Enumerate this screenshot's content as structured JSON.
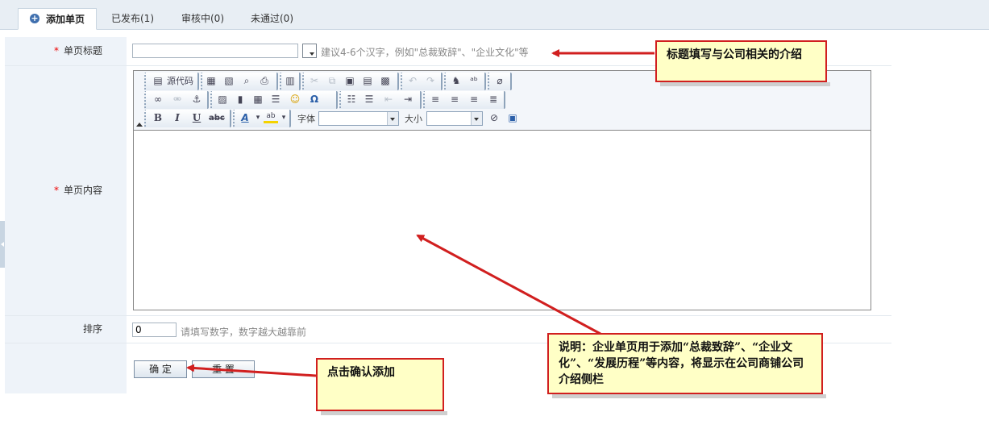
{
  "tabs": [
    {
      "label": "添加单页",
      "active": true
    },
    {
      "label": "已发布(1)",
      "active": false
    },
    {
      "label": "审核中(0)",
      "active": false
    },
    {
      "label": "未通过(0)",
      "active": false
    }
  ],
  "form": {
    "title_label": "单页标题",
    "required_mark": "*",
    "title_value": "",
    "title_hint": "建议4-6个汉字，例如\"总裁致辞\"、\"企业文化\"等",
    "content_label": "单页内容",
    "sort_label": "排序",
    "sort_value": "0",
    "sort_hint": "请填写数字，数字越大越靠前",
    "confirm_label": "确 定",
    "reset_label": "重 置"
  },
  "editor": {
    "source_label": "源代码",
    "font_label": "字体",
    "size_label": "大小",
    "bold": "B",
    "italic": "I",
    "underline": "U",
    "strike": "abc",
    "font_value": "",
    "size_value": ""
  },
  "callouts": {
    "title_note": "标题填写与公司相关的介绍",
    "content_note": "说明：企业单页用于添加“总裁致辞”、“企业文化”、“发展历程”等内容，将显示在公司商铺公司介绍侧栏",
    "confirm_note": "点击确认添加"
  },
  "colors": {
    "tab_bar": "#e8eef4",
    "label_column": "#eef3f9",
    "required": "#e00000",
    "callout_bg": "#ffffc6",
    "callout_border": "#d11f1f",
    "arrow": "#d11f1f"
  }
}
